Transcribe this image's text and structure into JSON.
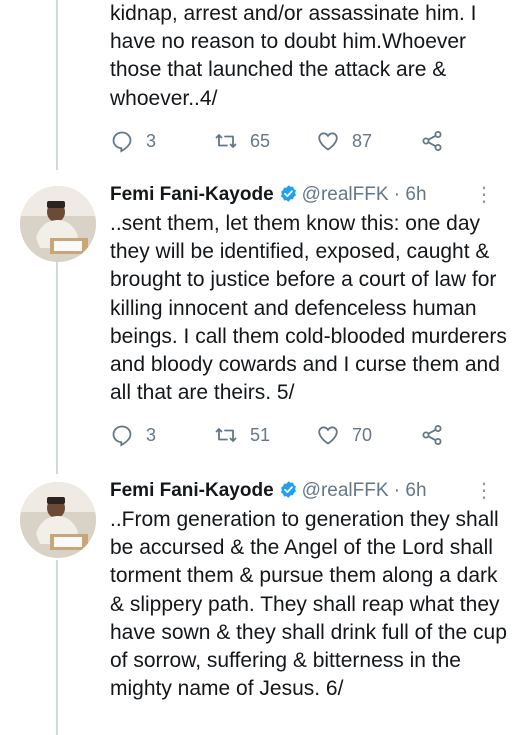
{
  "tweets": [
    {
      "text": "kidnap, arrest and/or assassinate him. I have no reason to doubt him.Whoever those that launched the attack are & whoever..4/",
      "replies": "3",
      "retweets": "65",
      "likes": "87"
    },
    {
      "name": "Femi Fani-Kayode",
      "handle": "@realFFK",
      "dot": "·",
      "time": "6h",
      "text": "..sent them, let them know this: one day they will be identified, exposed, caught & brought to justice before a court of law for killing innocent and defenceless human beings. I call them cold-blooded murderers and bloody cowards and I curse them and all that are theirs. 5/",
      "replies": "3",
      "retweets": "51",
      "likes": "70"
    },
    {
      "name": "Femi Fani-Kayode",
      "handle": "@realFFK",
      "dot": "·",
      "time": "6h",
      "text": "..From generation to generation they shall be accursed & the Angel of the Lord shall torment them & pursue them along a dark & slippery path. They shall reap what they have sown & they shall drink full of the cup of sorrow, suffering & bitterness in the mighty name of Jesus. 6/"
    }
  ],
  "colors": {
    "text": "#14171a",
    "muted": "#657786",
    "verified": "#1da1f2",
    "thread_line": "#cfd9de"
  },
  "icons": [
    "reply-icon",
    "retweet-icon",
    "like-icon",
    "share-icon",
    "verified-badge-icon",
    "more-options-icon"
  ]
}
